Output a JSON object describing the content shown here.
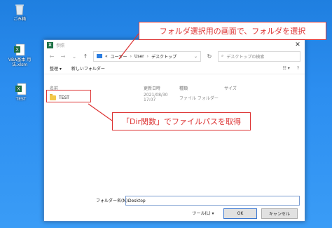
{
  "desktop": {
    "icons": [
      {
        "label": "ごみ箱",
        "icon": "recycle-bin-icon"
      },
      {
        "label": "VBA基本 用法.xlsm",
        "icon": "excel-file-icon"
      },
      {
        "label": "TEST",
        "icon": "excel-file-icon"
      }
    ]
  },
  "dialog": {
    "title": "参照",
    "address": {
      "segments": [
        "«",
        "ユーザー",
        "User",
        "デスクトップ"
      ]
    },
    "search_placeholder": "デスクトップの検索",
    "toolbar": {
      "organize": "整理 ▾",
      "new_folder": "新しいフォルダー"
    },
    "columns": [
      "名前",
      "更新日時",
      "種類",
      "サイズ"
    ],
    "rows": [
      {
        "name": "TEST",
        "date": "2021/08/30 17:07",
        "type": "ファイル フォルダー",
        "size": ""
      }
    ],
    "folder_name_label": "フォルダー名(N):",
    "folder_name_value": "Desktop",
    "tools_label": "ツール(L) ▾",
    "ok_label": "OK",
    "cancel_label": "キャンセル"
  },
  "callouts": {
    "top": "フォルダ選択用の画面で、フォルダを選択",
    "middle": "「Dir関数」でファイルパスを取得"
  },
  "colors": {
    "accent": "#d33333",
    "desktop": "#2c8ef0",
    "excel": "#1e7145"
  }
}
